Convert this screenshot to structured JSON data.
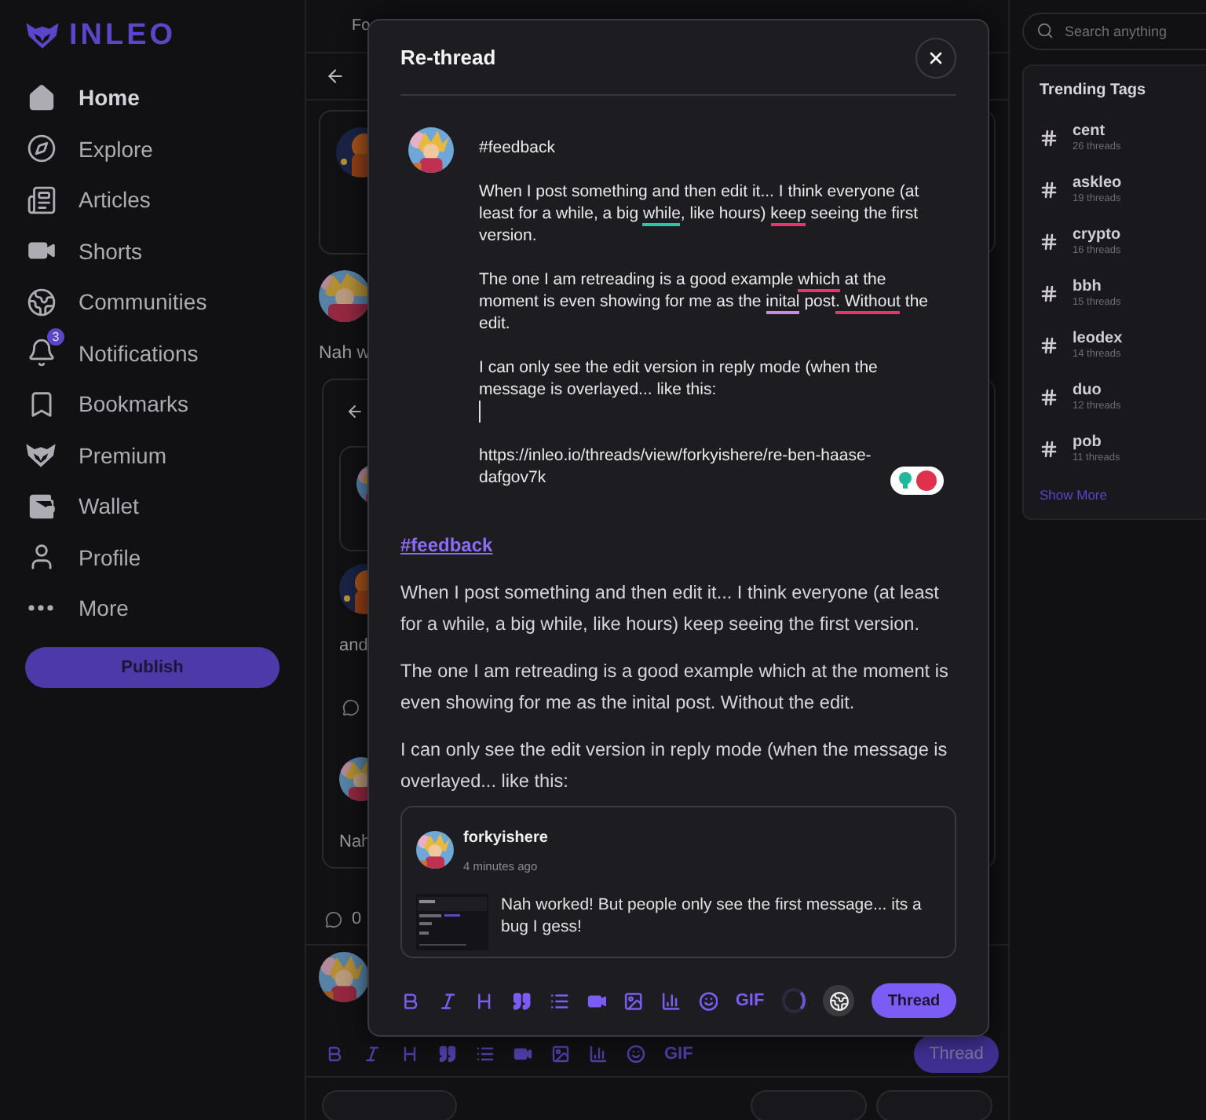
{
  "brand": {
    "name": "INLEO"
  },
  "nav": [
    {
      "label": "Home",
      "selected": true
    },
    {
      "label": "Explore",
      "selected": false
    },
    {
      "label": "Articles",
      "selected": false
    },
    {
      "label": "Shorts",
      "selected": false
    },
    {
      "label": "Communities",
      "selected": false
    },
    {
      "label": "Notifications",
      "selected": false,
      "badge": "3"
    },
    {
      "label": "Bookmarks",
      "selected": false
    },
    {
      "label": "Premium",
      "selected": false
    },
    {
      "label": "Wallet",
      "selected": false
    },
    {
      "label": "Profile",
      "selected": false
    },
    {
      "label": "More",
      "selected": false
    }
  ],
  "publish_button": "Publish",
  "feed": {
    "tab": "Fo",
    "text_fragments": [
      "Nah w",
      "and",
      "Nah"
    ],
    "comment_count": "0",
    "toolbar": {
      "gif": "GIF",
      "submit": "Thread"
    }
  },
  "dialog": {
    "title": "Re-thread",
    "editor": {
      "paragraphs": [
        [
          {
            "text": "#feedback"
          }
        ],
        [
          {
            "text": "When I post something and then edit it... I think everyone (at least for a while, a big "
          },
          {
            "text": "while",
            "color": "#2ec4a6"
          },
          {
            "text": ", like hours) "
          },
          {
            "text": "keep",
            "color": "#e8336b"
          },
          {
            "text": " seeing the first version."
          }
        ],
        [
          {
            "text": "The one I am retreading is a good example "
          },
          {
            "text": "which",
            "color": "#e8336b"
          },
          {
            "text": " at the moment is even showing for me as the "
          },
          {
            "text": "inital",
            "color": "#c98be8"
          },
          {
            "text": " post"
          },
          {
            "text": ". Without",
            "color": "#e8336b"
          },
          {
            "text": " the edit."
          }
        ],
        [
          {
            "text": "I can only see the edit version in reply mode (when the message is overlayed... like this:"
          }
        ]
      ],
      "cursor": true,
      "link": "https://inleo.io/threads/view/forkyishere/re-ben-haase-dafgov7k"
    },
    "preview": {
      "hashtag": "#feedback",
      "paragraphs": [
        "When I post something and then edit it... I think everyone (at least for a while, a big while, like hours) keep seeing the first version.",
        "The one I am retreading is a good example which at the moment is even showing for me as the inital post. Without the edit.",
        "I can only see the edit version in reply mode (when the message is overlayed... like this:"
      ],
      "quote": {
        "author": "forkyishere",
        "time": "4 minutes ago",
        "text": "Nah worked! But people only see the first message... its a bug I gess!"
      }
    },
    "toolbar": {
      "gif": "GIF",
      "submit": "Thread"
    }
  },
  "search": {
    "placeholder": "Search anything"
  },
  "trending": {
    "title": "Trending Tags",
    "tags": [
      {
        "name": "cent",
        "count": "26 threads"
      },
      {
        "name": "askleo",
        "count": "19 threads"
      },
      {
        "name": "crypto",
        "count": "16 threads"
      },
      {
        "name": "bbh",
        "count": "15 threads"
      },
      {
        "name": "leodex",
        "count": "14 threads"
      },
      {
        "name": "duo",
        "count": "12 threads"
      },
      {
        "name": "pob",
        "count": "11 threads"
      }
    ],
    "show_more": "Show More"
  }
}
